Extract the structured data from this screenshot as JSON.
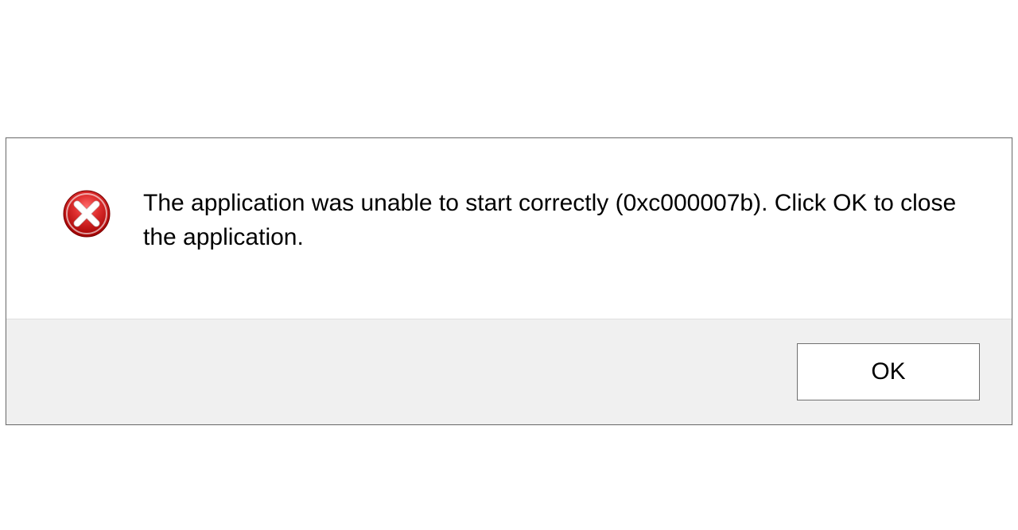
{
  "dialog": {
    "icon_name": "error-icon",
    "message": "The application was unable to start correctly (0xc000007b). Click OK to close the application.",
    "ok_label": "OK"
  }
}
